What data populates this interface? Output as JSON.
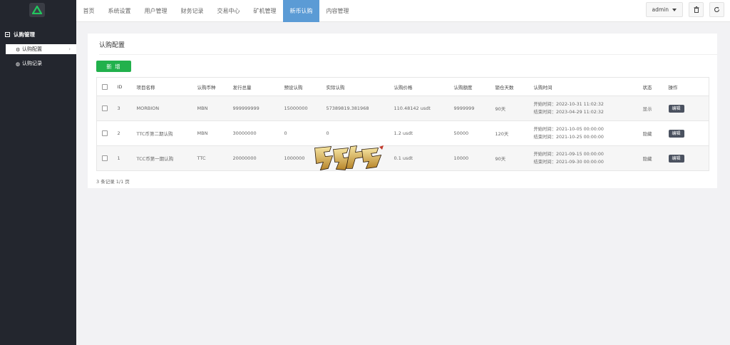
{
  "sidebar": {
    "group_label": "认购管理",
    "items": [
      {
        "label": "认购配置",
        "icon": "gear-icon"
      },
      {
        "label": "认购记录",
        "icon": "globe-icon"
      }
    ]
  },
  "nav": {
    "items": [
      "首页",
      "系统设置",
      "用户管理",
      "财务记录",
      "交易中心",
      "矿机管理",
      "新币认购",
      "内容管理"
    ],
    "active_index": 6
  },
  "top_right": {
    "user": "admin",
    "buttons": [
      "trash-icon",
      "refresh-icon"
    ]
  },
  "card": {
    "title": "认购配置",
    "add_button": "新 增",
    "columns": [
      "ID",
      "项目名称",
      "认购币种",
      "发行总量",
      "预设认购",
      "实际认购",
      "认购价格",
      "认购额度",
      "锁仓天数",
      "认购时间",
      "状态",
      "操作"
    ],
    "rows": [
      {
        "id": "3",
        "name": "MORBION",
        "coin": "MBN",
        "total": "999999999",
        "preset": "15000000",
        "actual": "57389819.381968",
        "price": "110.48142 usdt",
        "limit": "9999999",
        "lock_days": "90天",
        "start": "开始时间：2022-10-31 11:02:32",
        "end": "结束时间：2023-04-29 11:02:32",
        "status": "显示",
        "action": "编辑"
      },
      {
        "id": "2",
        "name": "TTC币第二期认购",
        "coin": "MBN",
        "total": "30000000",
        "preset": "0",
        "actual": "0",
        "price": "1.2 usdt",
        "limit": "50000",
        "lock_days": "120天",
        "start": "开始时间：2021-10-05 00:00:00",
        "end": "结束时间：2021-10-25 00:00:00",
        "status": "隐藏",
        "action": "编辑"
      },
      {
        "id": "1",
        "name": "TCC币第一期认购",
        "coin": "TTC",
        "total": "20000000",
        "preset": "1000000",
        "actual": "",
        "price": "0.1 usdt",
        "limit": "10000",
        "lock_days": "90天",
        "start": "开始时间：2021-09-15 00:00:00",
        "end": "结束时间：2021-09-30 00:00:00",
        "status": "隐藏",
        "action": "编辑"
      }
    ],
    "footer": "3 条记录 1/1 页"
  },
  "colors": {
    "sidebar_bg": "#23262e",
    "nav_active": "#5b9bd5",
    "add_button": "#22b14c",
    "edit_button": "#4b5260"
  }
}
